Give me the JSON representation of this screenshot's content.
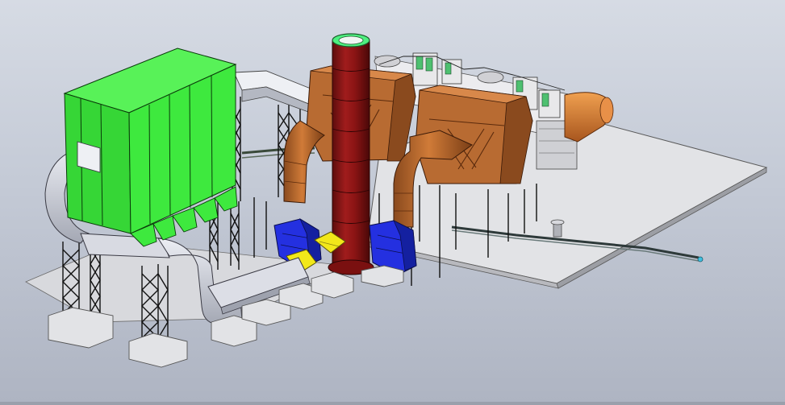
{
  "viewport": {
    "view": "isometric",
    "render_style": "shaded-with-edges",
    "background": {
      "top": "#d6dbe4",
      "bottom": "#aeb4c2"
    }
  },
  "model": {
    "components": [
      {
        "name": "baghouse-filter",
        "color": "#3ee93e"
      },
      {
        "name": "stack",
        "color": "#8b1414",
        "top_ring_color": "#4ef080"
      },
      {
        "name": "heat-recovery-unit-left",
        "color": "#b86b32"
      },
      {
        "name": "heat-recovery-unit-right",
        "color": "#b86b32"
      },
      {
        "name": "id-fan-left",
        "color": "#2430e0"
      },
      {
        "name": "id-fan-right",
        "color": "#2430e0"
      },
      {
        "name": "damper",
        "color": "#f2e81a"
      },
      {
        "name": "inlet-duct",
        "color": "#d88a3a"
      },
      {
        "name": "flue-ductwork",
        "color": "#c8cad4"
      },
      {
        "name": "support-structures",
        "color": "#1c1c1c"
      },
      {
        "name": "foundation-slab",
        "color": "#e4e4e6"
      },
      {
        "name": "pipe-rack",
        "color": "#4a6a4a"
      },
      {
        "name": "walkway-platform",
        "color": "#4ec070"
      }
    ]
  }
}
